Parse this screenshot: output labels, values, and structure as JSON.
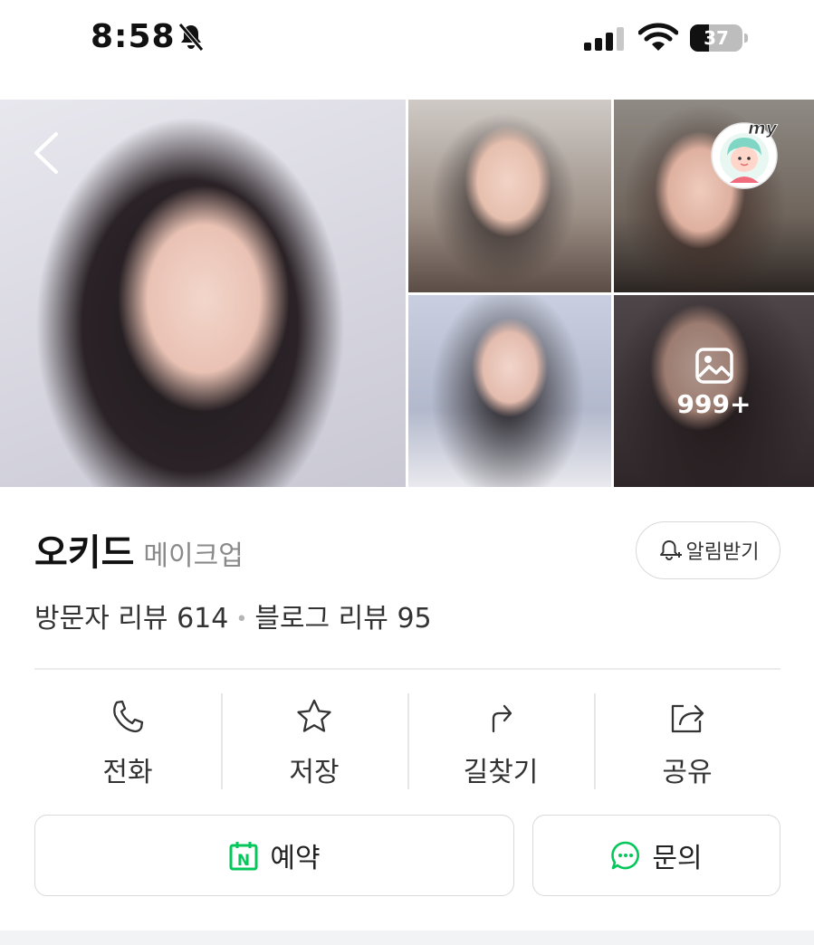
{
  "status_bar": {
    "time": "8:58",
    "battery": "37",
    "battery_level": 0.37
  },
  "gallery": {
    "more_count": "999+"
  },
  "place": {
    "name": "오키드",
    "category": "메이크업",
    "notify_label": "알림받기",
    "visitor_reviews_label": "방문자 리뷰",
    "visitor_reviews_count": "614",
    "blog_reviews_label": "블로그 리뷰",
    "blog_reviews_count": "95"
  },
  "actions": {
    "call": "전화",
    "save": "저장",
    "directions": "길찾기",
    "share": "공유"
  },
  "buttons": {
    "reserve": "예약",
    "inquiry": "문의"
  },
  "colors": {
    "naver_green": "#03c75a",
    "badge_mint": "#7fd6c4"
  }
}
